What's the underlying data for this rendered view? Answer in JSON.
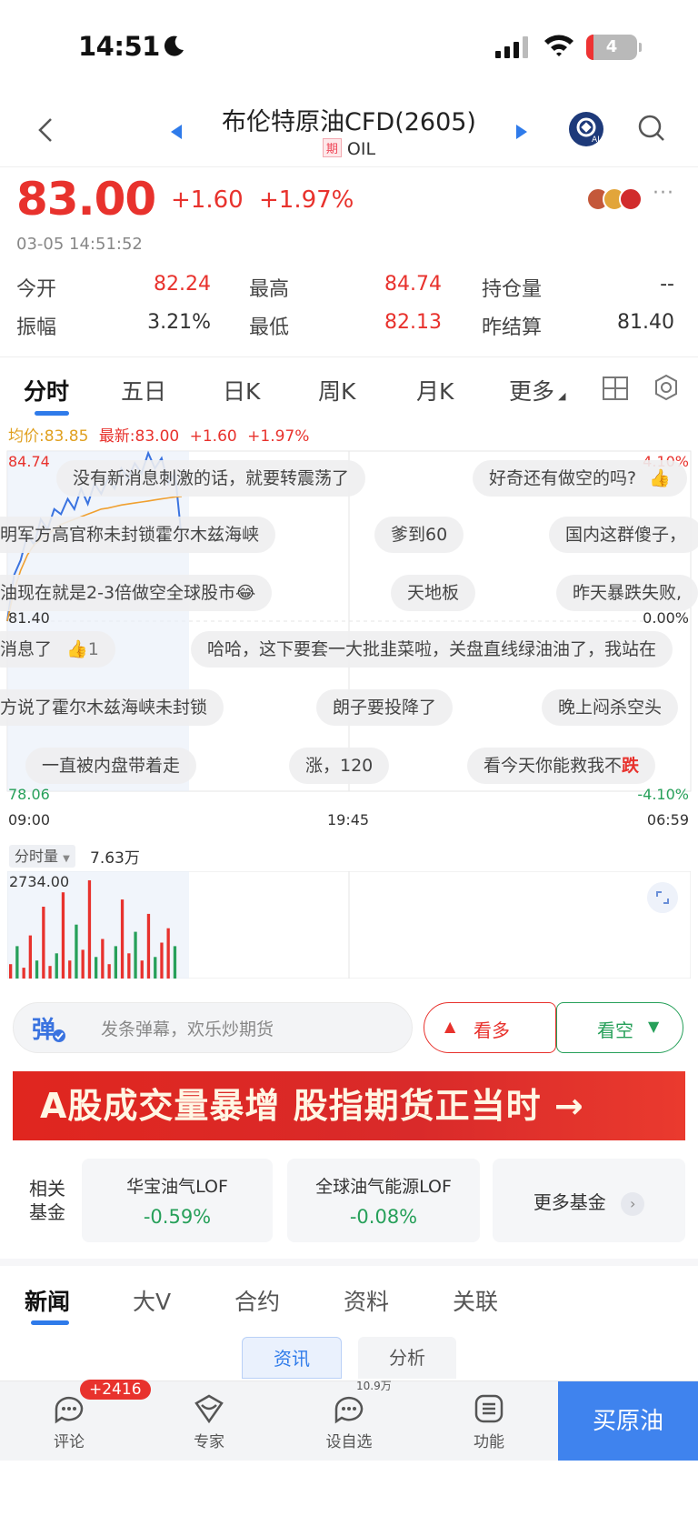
{
  "status": {
    "time": "14:51",
    "battery": "4"
  },
  "nav": {
    "title": "布伦特原油CFD(2605)",
    "badge": "期",
    "code": "OIL"
  },
  "quote": {
    "price": "83.00",
    "change": "+1.60",
    "change_pct": "+1.97%",
    "time": "03-05 14:51:52",
    "stats": [
      {
        "label": "今开",
        "value": "82.24",
        "color": "#e8322d"
      },
      {
        "label": "最高",
        "value": "84.74",
        "color": "#e8322d"
      },
      {
        "label": "持仓量",
        "value": "--",
        "color": "#333333"
      },
      {
        "label": "振幅",
        "value": "3.21%",
        "color": "#333333"
      },
      {
        "label": "最低",
        "value": "82.13",
        "color": "#e8322d"
      },
      {
        "label": "昨结算",
        "value": "81.40",
        "color": "#333333"
      }
    ]
  },
  "chart_tabs": [
    "分时",
    "五日",
    "日K",
    "周K",
    "月K",
    "更多"
  ],
  "chart_info": {
    "avg": "均价:83.85",
    "latest": "最新:83.00",
    "change": "+1.60",
    "change_pct": "+1.97%"
  },
  "chart_axes": {
    "y_high": "84.74",
    "y_mid": "81.40",
    "y_low": "78.06",
    "pct_high": "4.10%",
    "pct_mid": "0.00%",
    "pct_low": "-4.10%",
    "x_start": "09:00",
    "x_mid": "19:45",
    "x_end": "06:59"
  },
  "chart_data": {
    "type": "line",
    "ylim": [
      78.06,
      84.74
    ],
    "series": [
      {
        "values": [
          81.4,
          82.3,
          82.6,
          83.1,
          82.9,
          83.4,
          83.2,
          83.6,
          83.5,
          83.8,
          83.6,
          84.0,
          83.7,
          84.1,
          83.9,
          84.2,
          84.0,
          84.4,
          84.2,
          84.5,
          84.3,
          84.7,
          84.4,
          84.6,
          84.1,
          84.3,
          83.0
        ]
      },
      {
        "values": [
          81.4,
          82.0,
          82.4,
          82.7,
          82.9,
          83.0,
          83.1,
          83.2,
          83.3,
          83.35,
          83.4,
          83.45,
          83.5,
          83.55,
          83.6,
          83.62,
          83.65,
          83.68,
          83.7,
          83.72,
          83.74,
          83.76,
          83.78,
          83.8,
          83.82,
          83.84,
          83.85
        ]
      }
    ]
  },
  "danmaku": [
    "没有新消息刺激的话，就要转震荡了",
    "好奇还有做空的吗?",
    "明军方高官称未封锁霍尔木兹海峡",
    "爹到60",
    "国内这群傻子，",
    "油现在就是2-3倍做空全球股市😂",
    "天地板",
    "昨天暴跌失败,",
    "消息了",
    "哈哈，这下要套一大批韭菜啦，关盘直线绿油油了，我站在",
    "方说了霍尔木兹海峡未封锁",
    "朗子要投降了",
    "晚上闷杀空头",
    "一直被内盘带着走",
    "涨，120",
    "看今天你能救我不",
    "跌"
  ],
  "danmaku_like_count": "1",
  "volume": {
    "label": "分时量",
    "total": "7.63万",
    "max": "2734.00"
  },
  "volume_data": {
    "type": "bar",
    "values": [
      400,
      900,
      300,
      1200,
      500,
      2000,
      350,
      700,
      2400,
      500,
      1500,
      800,
      2734,
      600,
      1100,
      400,
      900,
      2200,
      700,
      1300,
      500,
      1800,
      600,
      1000,
      1400,
      900
    ]
  },
  "comment": {
    "placeholder": "发条弹幕，欢乐炒期货",
    "bull": "看多",
    "bear": "看空"
  },
  "banner": {
    "text": "A股成交量暴增 股指期货正当时 →"
  },
  "funds": {
    "label": "相关基金",
    "items": [
      {
        "name": "华宝油气LOF",
        "change": "-0.59%"
      },
      {
        "name": "全球油气能源LOF",
        "change": "-0.08%"
      }
    ],
    "more": "更多基金"
  },
  "news_tabs": [
    "新闻",
    "大V",
    "合约",
    "资料",
    "关联"
  ],
  "news_subtabs": [
    "资讯",
    "分析"
  ],
  "toolbar": {
    "items": [
      "评论",
      "专家",
      "设自选",
      "功能"
    ],
    "comment_badge": "+2416",
    "watch_badge": "10.9万",
    "buy": "买原油"
  }
}
